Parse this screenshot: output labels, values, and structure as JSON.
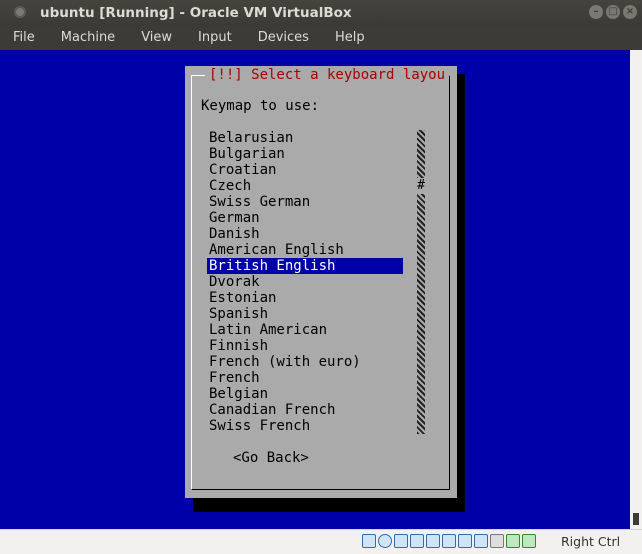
{
  "window": {
    "title": "ubuntu [Running] - Oracle VM VirtualBox"
  },
  "menubar": {
    "items": [
      "File",
      "Machine",
      "View",
      "Input",
      "Devices",
      "Help"
    ]
  },
  "dialog": {
    "title": "[!!] Select a keyboard layou",
    "prompt": "Keymap to use:",
    "keymaps": [
      "Belarusian",
      "Bulgarian",
      "Croatian",
      "Czech",
      "Swiss German",
      "German",
      "Danish",
      "American English",
      "British English",
      "Dvorak",
      "Estonian",
      "Spanish",
      "Latin American",
      "Finnish",
      "French (with euro)",
      "French",
      "Belgian",
      "Canadian French",
      "Swiss French"
    ],
    "selected": "British English",
    "scroll_marker": "#",
    "go_back": "<Go Back>"
  },
  "statusbar": {
    "icons": [
      "hard-disk-icon",
      "optical-drive-icon",
      "audio-icon",
      "network-icon",
      "usb-icon",
      "shared-folders-icon",
      "display-icon",
      "video-capture-icon",
      "virtualization-icon",
      "mouse-integration-icon",
      "keyboard-capture-icon"
    ],
    "host_key": "Right Ctrl"
  }
}
